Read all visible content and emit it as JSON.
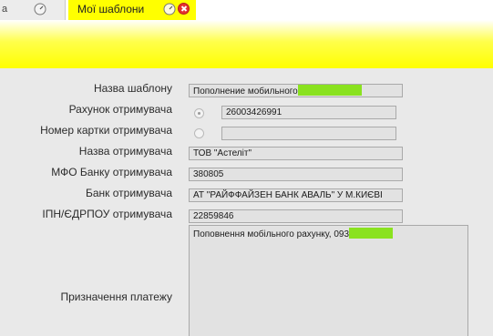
{
  "tabs": {
    "inactive_label": "а",
    "active_label": "Мої шаблони"
  },
  "colors": {
    "accent": "#ffff00",
    "redaction": "#8ae21f",
    "close": "#e53030"
  },
  "form": {
    "template_name": {
      "label": "Назва шаблону",
      "value": "Пополнение мобильного"
    },
    "account": {
      "label": "Рахунок отримувача",
      "value": "26003426991",
      "selected": true
    },
    "card": {
      "label": "Номер картки отримувача",
      "value": "",
      "selected": false
    },
    "recipient_name": {
      "label": "Назва отримувача",
      "value": "ТОВ \"Астеліт\""
    },
    "mfo": {
      "label": "МФО Банку отримувача",
      "value": "380805"
    },
    "bank": {
      "label": "Банк отримувача",
      "value": "АТ \"РАЙФФАЙЗЕН БАНК АВАЛЬ\"  У  М.КИЄВІ"
    },
    "tax_id": {
      "label": "ІПН/ЄДРПОУ отримувача",
      "value": "22859846"
    },
    "purpose": {
      "label": "Призначення платежу",
      "value": "Поповнення мобільного рахунку, 093"
    }
  }
}
